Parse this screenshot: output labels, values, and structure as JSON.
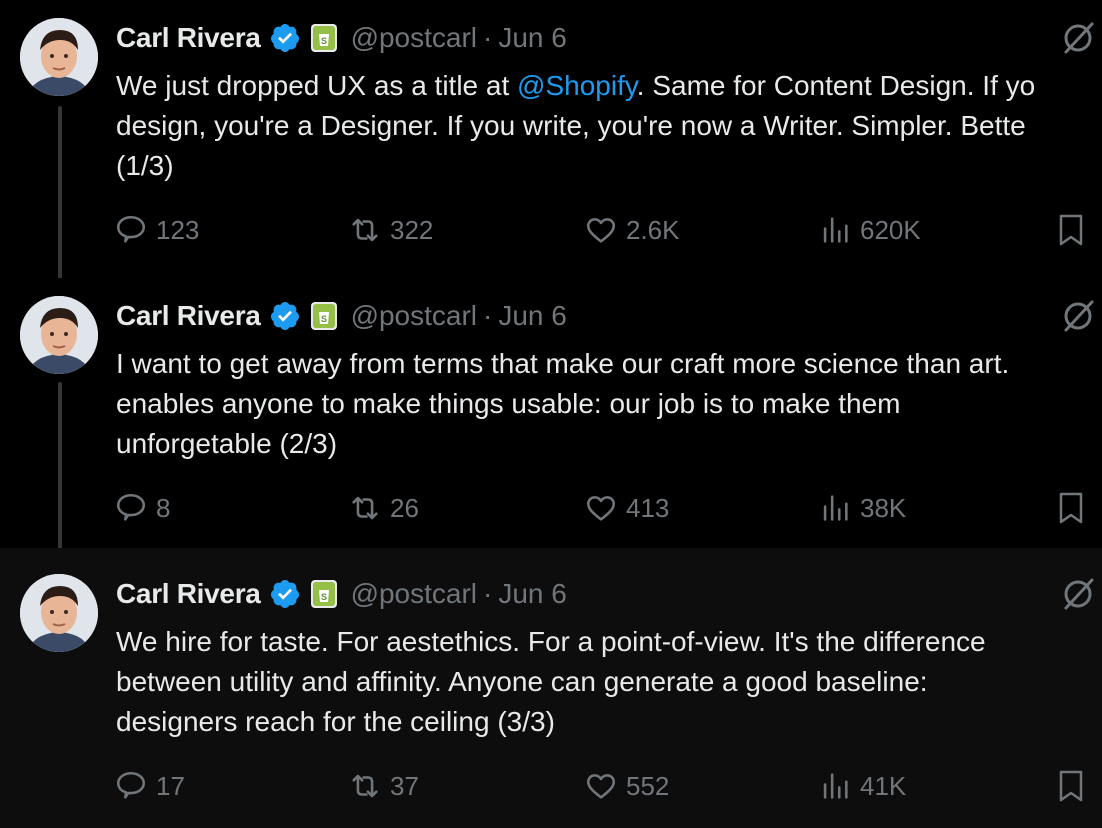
{
  "tweets": [
    {
      "author": "Carl Rivera",
      "handle": "@postcarl",
      "separator": "·",
      "date": "Jun 6",
      "lines": [
        {
          "pre": "We just dropped UX as a title at ",
          "mention": "@Shopify",
          "post": ". Same for Content Design. If yo"
        },
        {
          "pre": "design, you're a Designer. If you write, you're now a Writer. Simpler. Bette",
          "mention": "",
          "post": ""
        },
        {
          "pre": "(1/3)",
          "mention": "",
          "post": ""
        }
      ],
      "replies": "123",
      "reposts": "322",
      "likes": "2.6K",
      "views": "620K"
    },
    {
      "author": "Carl Rivera",
      "handle": "@postcarl",
      "separator": "·",
      "date": "Jun 6",
      "lines": [
        {
          "pre": "I want to get away from terms that make our craft more science than art.",
          "mention": "",
          "post": ""
        },
        {
          "pre": "enables anyone to make things usable: our job is to make them",
          "mention": "",
          "post": ""
        },
        {
          "pre": "unforgetable (2/3)",
          "mention": "",
          "post": ""
        }
      ],
      "replies": "8",
      "reposts": "26",
      "likes": "413",
      "views": "38K"
    },
    {
      "author": "Carl Rivera",
      "handle": "@postcarl",
      "separator": "·",
      "date": "Jun 6",
      "lines": [
        {
          "pre": "We hire for taste. For aestethics. For a point-of-view. It's the difference",
          "mention": "",
          "post": ""
        },
        {
          "pre": "between utility and affinity. Anyone can generate a good baseline:",
          "mention": "",
          "post": ""
        },
        {
          "pre": "designers reach for the ceiling (3/3)",
          "mention": "",
          "post": ""
        }
      ],
      "replies": "17",
      "reposts": "37",
      "likes": "552",
      "views": "41K"
    }
  ],
  "colors": {
    "background": "#000000",
    "text": "#e7e9ea",
    "muted": "#71767b",
    "mention": "#1d9bf0",
    "verified": "#1d9bf0",
    "shop_badge": "#95bf47"
  },
  "icons": [
    "verified-badge-icon",
    "shopify-badge-icon",
    "grok-icon",
    "reply-icon",
    "repost-icon",
    "like-icon",
    "views-icon",
    "bookmark-icon"
  ]
}
